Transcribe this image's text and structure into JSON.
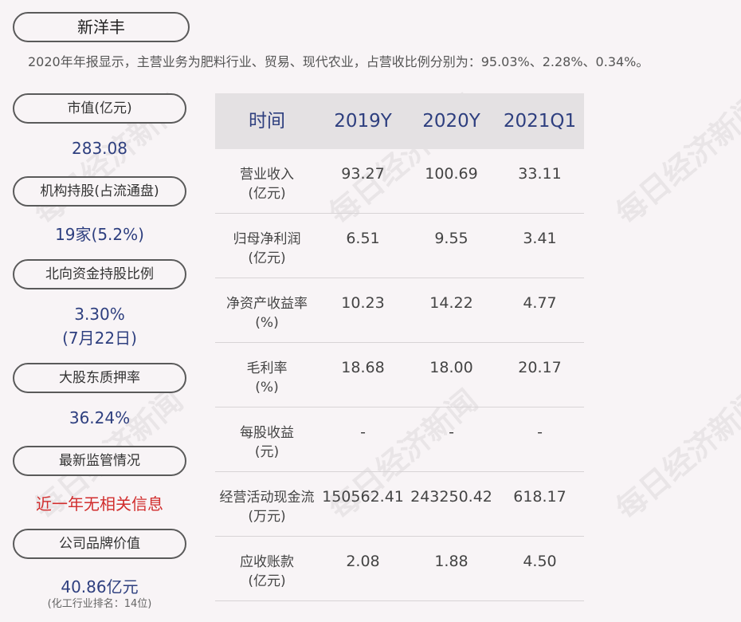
{
  "company": "新洋丰",
  "intro": "2020年年报显示，主营业务为肥料行业、贸易、现代农业，占营收比例分别为：95.03%、2.28%、0.34%。",
  "sidebar": [
    {
      "label": "市值(亿元)",
      "value": "283.08"
    },
    {
      "label": "机构持股(占流通盘)",
      "value": "19家(5.2%)"
    },
    {
      "label": "北向资金持股比例",
      "value": "3.30%",
      "value2": "(7月22日)"
    },
    {
      "label": "大股东质押率",
      "value": "36.24%"
    },
    {
      "label": "最新监管情况",
      "value": "近一年无相关信息"
    },
    {
      "label": "公司品牌价值",
      "value": "40.86亿元",
      "note": "(化工行业排名：14位)"
    }
  ],
  "table": {
    "headers": [
      "时间",
      "2019Y",
      "2020Y",
      "2021Q1"
    ],
    "rows": [
      {
        "label1": "营业收入",
        "label2": "(亿元)",
        "values": [
          "93.27",
          "100.69",
          "33.11"
        ]
      },
      {
        "label1": "归母净利润",
        "label2": "(亿元)",
        "values": [
          "6.51",
          "9.55",
          "3.41"
        ]
      },
      {
        "label1": "净资产收益率",
        "label2": "(%)",
        "values": [
          "10.23",
          "14.22",
          "4.77"
        ]
      },
      {
        "label1": "毛利率",
        "label2": "(%)",
        "values": [
          "18.68",
          "18.00",
          "20.17"
        ]
      },
      {
        "label1": "每股收益",
        "label2": "(元)",
        "values": [
          "-",
          "-",
          "-"
        ]
      },
      {
        "label1": "经营活动现金流",
        "label2": "(万元)",
        "values": [
          "150562.41",
          "243250.42",
          "618.17"
        ]
      },
      {
        "label1": "应收账款",
        "label2": "(亿元)",
        "values": [
          "2.08",
          "1.88",
          "4.50"
        ]
      }
    ]
  },
  "watermark": "每日经济新闻",
  "colors": {
    "value": "#2e3f7f",
    "alert": "#d12d2d",
    "header_bg": "#e4e1e3",
    "background": "#f8f4f6"
  }
}
